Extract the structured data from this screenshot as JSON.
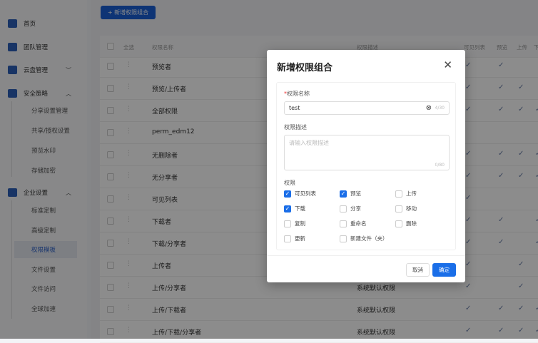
{
  "sidebar": {
    "items": [
      {
        "label": "首页",
        "icon": "home-icon",
        "chevron": ""
      },
      {
        "label": "团队管理",
        "icon": "team-icon",
        "chevron": ""
      },
      {
        "label": "云盘管理",
        "icon": "cloud-disk-icon",
        "chevron": "﹀"
      },
      {
        "label": "安全策略",
        "icon": "security-icon",
        "chevron": "︿"
      },
      {
        "label": "企业设置",
        "icon": "settings-icon",
        "chevron": "︿"
      }
    ],
    "security_sub": [
      "分享设置管理",
      "共享/授权设置",
      "预览水印",
      "存储加密"
    ],
    "enterprise_sub": [
      "标准定制",
      "高级定制",
      "权限模板",
      "文件设置",
      "文件访问",
      "全球加速"
    ],
    "active": "权限模板"
  },
  "toolbar": {
    "add_label": "+ 新增权限组合"
  },
  "table": {
    "headers": {
      "select_all": "全选",
      "name": "权限名称",
      "desc": "权限描述",
      "visible": "可见列表",
      "preview": "预览",
      "upload": "上传",
      "download": "下"
    },
    "rows": [
      {
        "name": "预览者",
        "desc": "",
        "perms": [
          1,
          1,
          0,
          0
        ]
      },
      {
        "name": "预览/上传者",
        "desc": "",
        "perms": [
          1,
          1,
          1,
          0
        ]
      },
      {
        "name": "全部权限",
        "desc": "",
        "perms": [
          1,
          1,
          1,
          1
        ]
      },
      {
        "name": "perm_edm12",
        "desc": "",
        "perms": [
          0,
          0,
          0,
          0
        ]
      },
      {
        "name": "无删除者",
        "desc": "",
        "perms": [
          1,
          1,
          1,
          1
        ]
      },
      {
        "name": "无分享者",
        "desc": "",
        "perms": [
          1,
          1,
          1,
          1
        ]
      },
      {
        "name": "可见列表",
        "desc": "",
        "perms": [
          1,
          0,
          0,
          0
        ]
      },
      {
        "name": "下载者",
        "desc": "",
        "perms": [
          1,
          1,
          0,
          1
        ]
      },
      {
        "name": "下载/分享者",
        "desc": "",
        "perms": [
          1,
          1,
          0,
          1
        ]
      },
      {
        "name": "上传者",
        "desc": "",
        "perms": [
          1,
          0,
          1,
          0
        ]
      },
      {
        "name": "上传/分享者",
        "desc": "系统默认权限",
        "perms": [
          1,
          0,
          1,
          0
        ]
      },
      {
        "name": "上传/下载者",
        "desc": "系统默认权限",
        "perms": [
          1,
          1,
          1,
          1
        ]
      },
      {
        "name": "上传/下载/分享者",
        "desc": "系统默认权限",
        "perms": [
          1,
          1,
          1,
          1
        ]
      }
    ]
  },
  "modal": {
    "title": "新增权限组合",
    "name_label": "权限名称",
    "name_required": "*",
    "name_value": "test",
    "name_counter": "4/30",
    "desc_label": "权限描述",
    "desc_placeholder": "请输入权限描述",
    "desc_counter": "0/80",
    "perm_label": "权限",
    "options": [
      {
        "label": "可见列表",
        "checked": true
      },
      {
        "label": "预览",
        "checked": true
      },
      {
        "label": "上传",
        "checked": false
      },
      {
        "label": "下载",
        "checked": true
      },
      {
        "label": "分享",
        "checked": false
      },
      {
        "label": "移动",
        "checked": false
      },
      {
        "label": "复制",
        "checked": false
      },
      {
        "label": "重命名",
        "checked": false
      },
      {
        "label": "删除",
        "checked": false
      },
      {
        "label": "更新",
        "checked": false
      },
      {
        "label": "新建文件（夹）",
        "checked": false
      }
    ],
    "cancel_label": "取消",
    "ok_label": "确定"
  },
  "colors": {
    "primary": "#1a6ee8",
    "overlay": "rgba(0,0,0,0.45)"
  }
}
